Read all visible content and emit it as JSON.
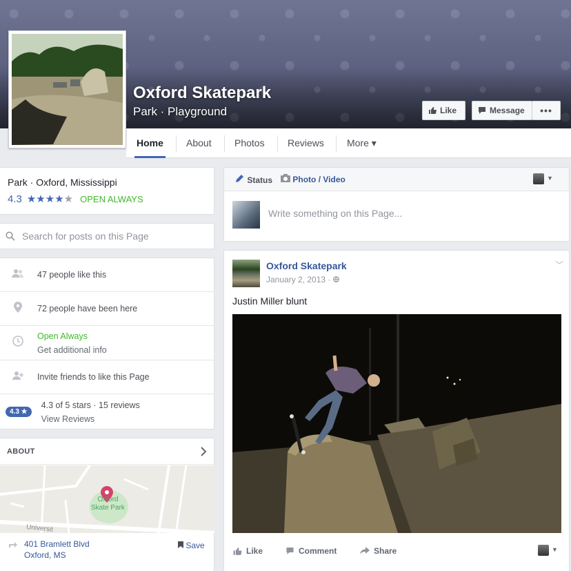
{
  "page": {
    "name": "Oxford Skatepark",
    "subtitle": "Park · Playground"
  },
  "cover_buttons": {
    "like": "Like",
    "message": "Message",
    "more": "•••"
  },
  "tabs": [
    {
      "label": "Home",
      "active": true
    },
    {
      "label": "About"
    },
    {
      "label": "Photos"
    },
    {
      "label": "Reviews"
    },
    {
      "label": "More ▾"
    }
  ],
  "info": {
    "category_location": "Park · Oxford, Mississippi",
    "rating": "4.3",
    "stars": 4.3,
    "hours_status": "OPEN ALWAYS"
  },
  "search": {
    "placeholder": "Search for posts on this Page"
  },
  "stats": {
    "likes": "47 people like this",
    "checkins": "72 people have been here",
    "open": "Open Always",
    "additional": "Get additional info",
    "invite": "Invite friends to like this Page",
    "badge": "4.3 ★",
    "reviews_summary": "4.3 of 5 stars · 15 reviews",
    "view_reviews": "View Reviews"
  },
  "about": {
    "heading": "ABOUT",
    "map_label_1": "Oxford",
    "map_label_2": "Skate Park",
    "map_street": "Universit",
    "address_line1": "401 Bramlett Blvd",
    "address_line2": "Oxford, MS",
    "save": "Save"
  },
  "composer": {
    "status": "Status",
    "photo_video": "Photo / Video",
    "placeholder": "Write something on this Page..."
  },
  "post": {
    "author": "Oxford Skatepark",
    "date": "January 2, 2013 · ",
    "caption": "Justin Miller blunt",
    "actions": {
      "like": "Like",
      "comment": "Comment",
      "share": "Share"
    }
  },
  "colors": {
    "brand_blue": "#4267b2",
    "link_blue": "#365899",
    "open_green": "#42b72a",
    "cover": "#5c6180"
  }
}
